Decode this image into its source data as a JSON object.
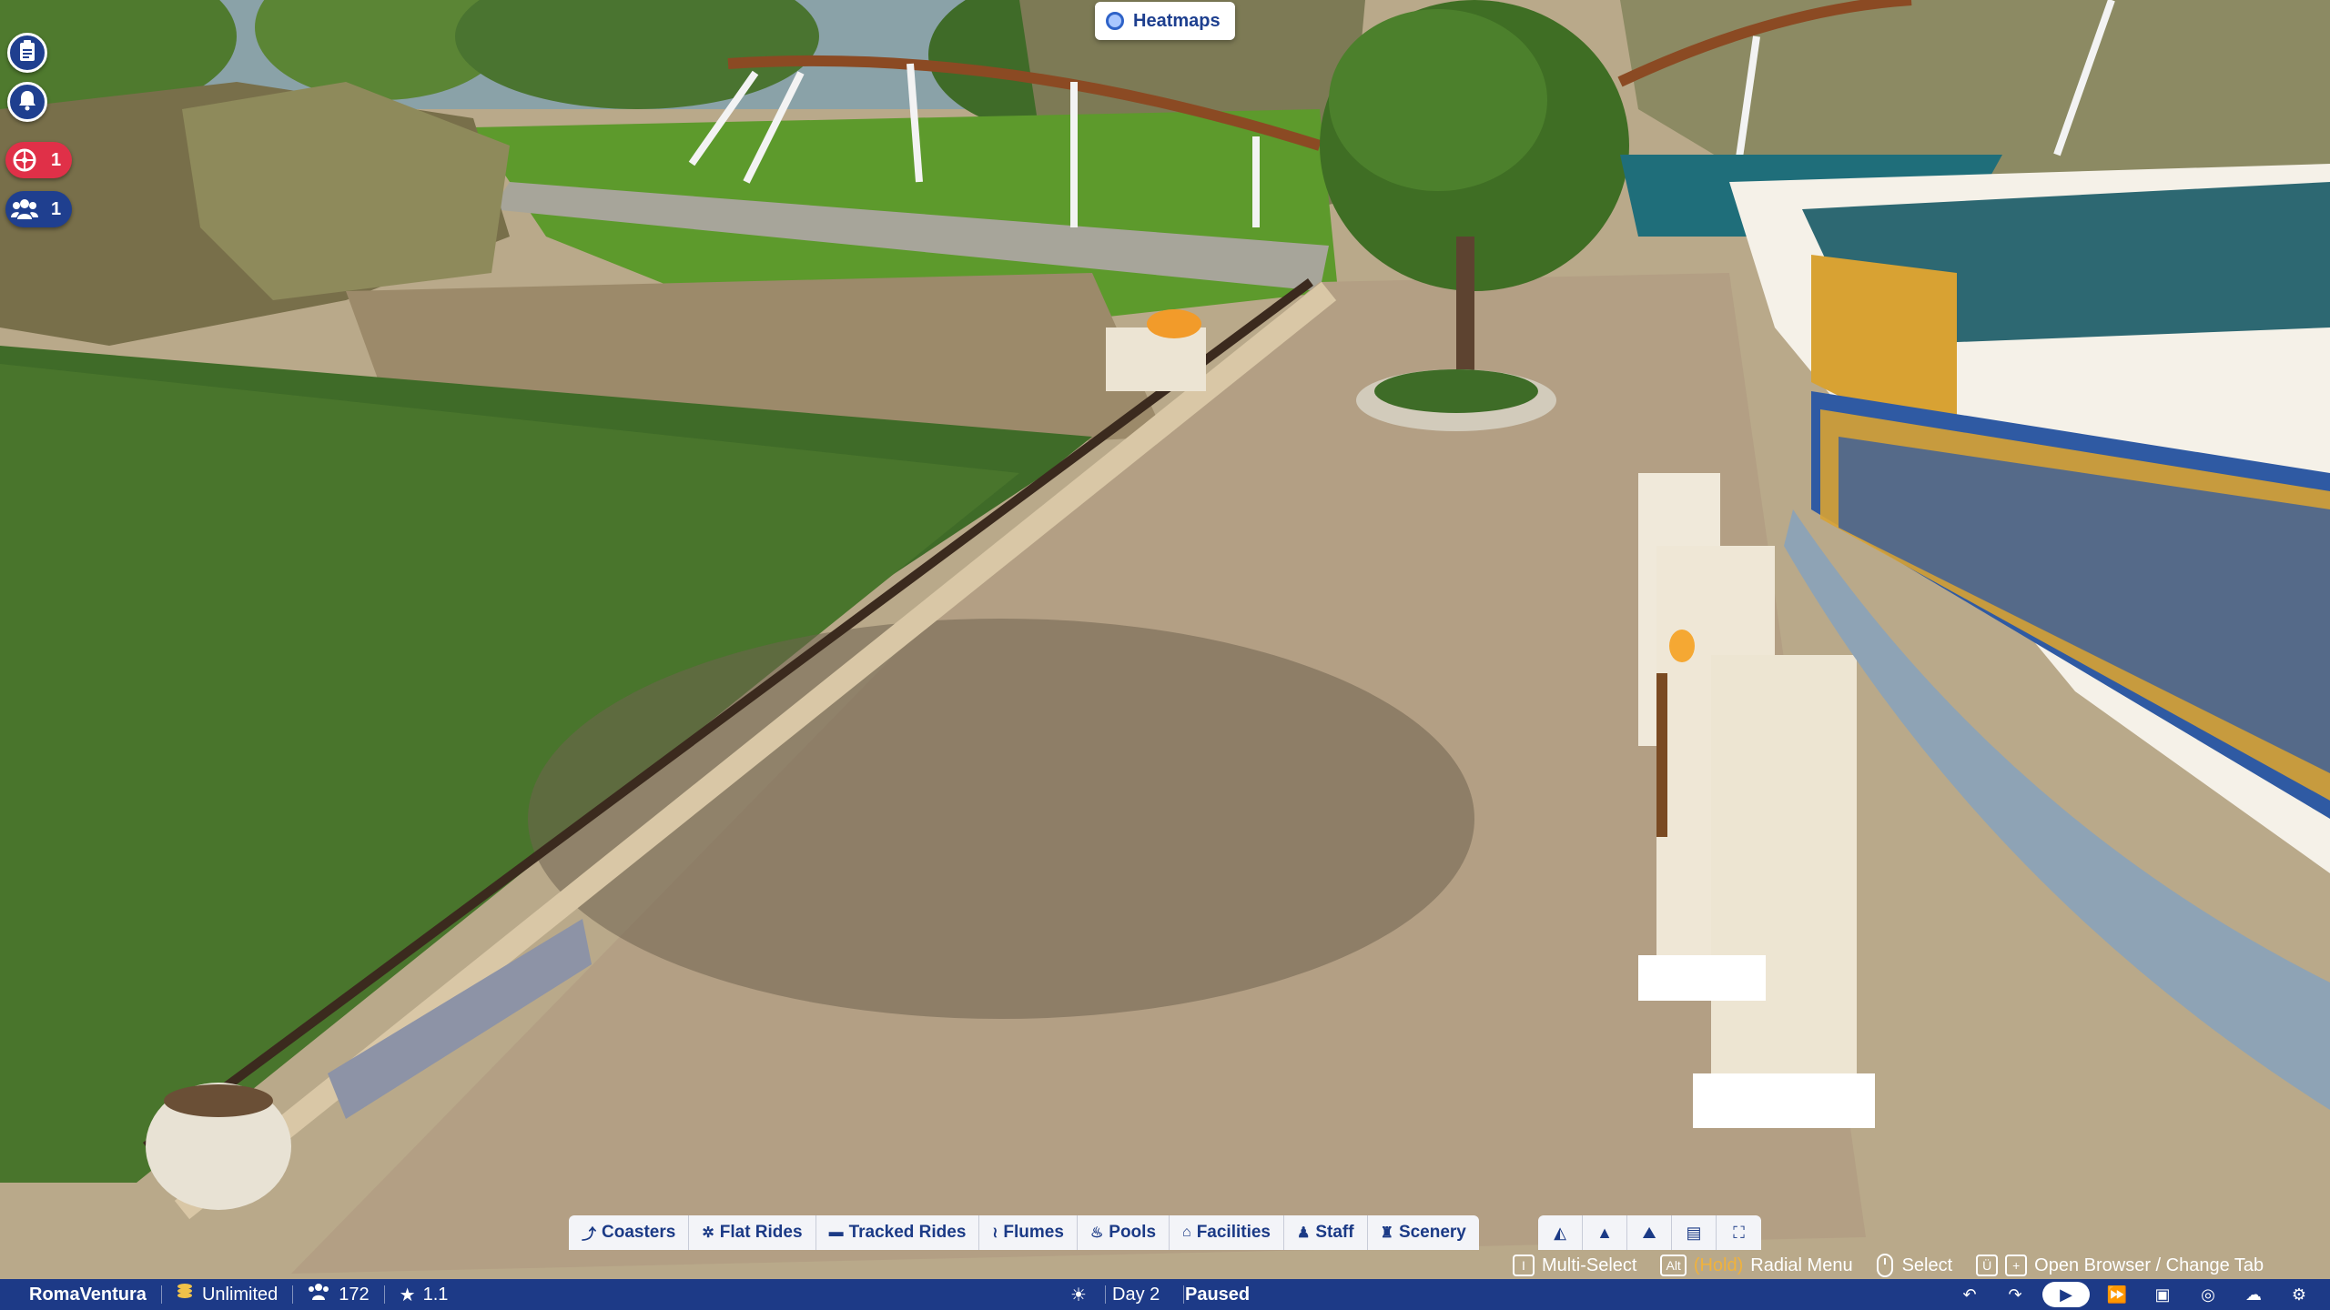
{
  "heatmaps": {
    "label": "Heatmaps"
  },
  "left_hud": {
    "alerts_count": "1",
    "guests_count": "1"
  },
  "build_tabs": [
    {
      "label": "Coasters",
      "icon": "coaster-icon"
    },
    {
      "label": "Flat Rides",
      "icon": "flat-ride-icon"
    },
    {
      "label": "Tracked Rides",
      "icon": "tracked-ride-icon"
    },
    {
      "label": "Flumes",
      "icon": "flume-icon"
    },
    {
      "label": "Pools",
      "icon": "pool-icon"
    },
    {
      "label": "Facilities",
      "icon": "facilities-icon"
    },
    {
      "label": "Staff",
      "icon": "staff-icon"
    },
    {
      "label": "Scenery",
      "icon": "scenery-icon"
    }
  ],
  "mode_buttons": [
    "paths-icon",
    "terraform-icon",
    "terrain-icon",
    "blueprints-icon",
    "fullscreen-icon"
  ],
  "hints": {
    "multi_select_key": "I",
    "multi_select": "Multi-Select",
    "radial_key": "Alt",
    "radial_hold": "(Hold)",
    "radial_menu": "Radial Menu",
    "select": "Select",
    "browser_key1": "Ü",
    "browser_key2": "+",
    "open_browser": "Open Browser / Change Tab"
  },
  "status": {
    "park_name": "RomaVentura",
    "money": "Unlimited",
    "guests": "172",
    "rating": "1.1",
    "day": "Day 2",
    "state": "Paused"
  },
  "colors": {
    "hud_blue": "#1d3a87",
    "alert_red": "#e03048",
    "toolbar_bg": "#f3f4f8",
    "hold_orange": "#f0b23c"
  }
}
